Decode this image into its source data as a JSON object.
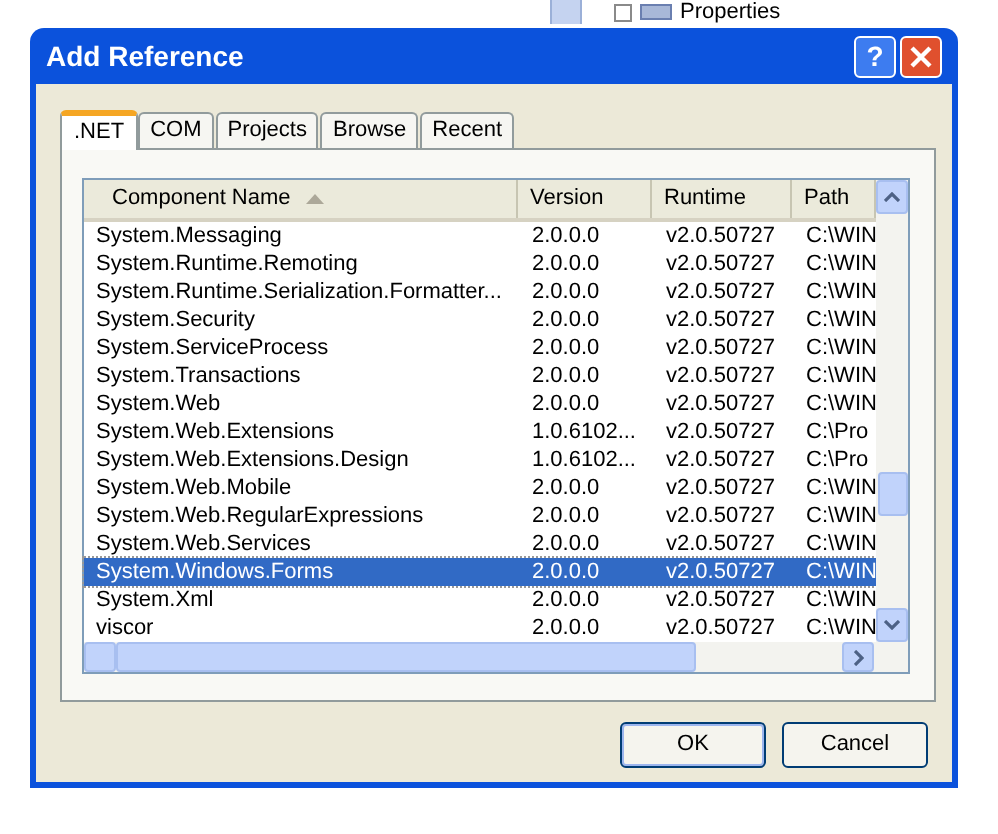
{
  "background": {
    "tree_item": "Properties"
  },
  "window": {
    "title": "Add Reference",
    "help_glyph": "?"
  },
  "tabs": [
    {
      "label": ".NET",
      "selected": true
    },
    {
      "label": "COM",
      "selected": false
    },
    {
      "label": "Projects",
      "selected": false
    },
    {
      "label": "Browse",
      "selected": false
    },
    {
      "label": "Recent",
      "selected": false
    }
  ],
  "table": {
    "columns": [
      "Component Name",
      "Version",
      "Runtime",
      "Path"
    ],
    "rows": [
      {
        "cells": [
          "System.Messaging",
          "2.0.0.0",
          "v2.0.50727",
          "C:\\WIN"
        ],
        "selected": false
      },
      {
        "cells": [
          "System.Runtime.Remoting",
          "2.0.0.0",
          "v2.0.50727",
          "C:\\WIN"
        ],
        "selected": false
      },
      {
        "cells": [
          "System.Runtime.Serialization.Formatter...",
          "2.0.0.0",
          "v2.0.50727",
          "C:\\WIN"
        ],
        "selected": false
      },
      {
        "cells": [
          "System.Security",
          "2.0.0.0",
          "v2.0.50727",
          "C:\\WIN"
        ],
        "selected": false
      },
      {
        "cells": [
          "System.ServiceProcess",
          "2.0.0.0",
          "v2.0.50727",
          "C:\\WIN"
        ],
        "selected": false
      },
      {
        "cells": [
          "System.Transactions",
          "2.0.0.0",
          "v2.0.50727",
          "C:\\WIN"
        ],
        "selected": false
      },
      {
        "cells": [
          "System.Web",
          "2.0.0.0",
          "v2.0.50727",
          "C:\\WIN"
        ],
        "selected": false
      },
      {
        "cells": [
          "System.Web.Extensions",
          "1.0.6102...",
          "v2.0.50727",
          "C:\\Pro"
        ],
        "selected": false
      },
      {
        "cells": [
          "System.Web.Extensions.Design",
          "1.0.6102...",
          "v2.0.50727",
          "C:\\Pro"
        ],
        "selected": false
      },
      {
        "cells": [
          "System.Web.Mobile",
          "2.0.0.0",
          "v2.0.50727",
          "C:\\WIN"
        ],
        "selected": false
      },
      {
        "cells": [
          "System.Web.RegularExpressions",
          "2.0.0.0",
          "v2.0.50727",
          "C:\\WIN"
        ],
        "selected": false
      },
      {
        "cells": [
          "System.Web.Services",
          "2.0.0.0",
          "v2.0.50727",
          "C:\\WIN"
        ],
        "selected": false
      },
      {
        "cells": [
          "System.Windows.Forms",
          "2.0.0.0",
          "v2.0.50727",
          "C:\\WIN"
        ],
        "selected": true
      },
      {
        "cells": [
          "System.Xml",
          "2.0.0.0",
          "v2.0.50727",
          "C:\\WIN"
        ],
        "selected": false
      },
      {
        "cells": [
          "viscor",
          "2.0.0.0",
          "v2.0.50727",
          "C:\\WIN"
        ],
        "selected": false
      }
    ]
  },
  "buttons": [
    "OK",
    "Cancel"
  ]
}
